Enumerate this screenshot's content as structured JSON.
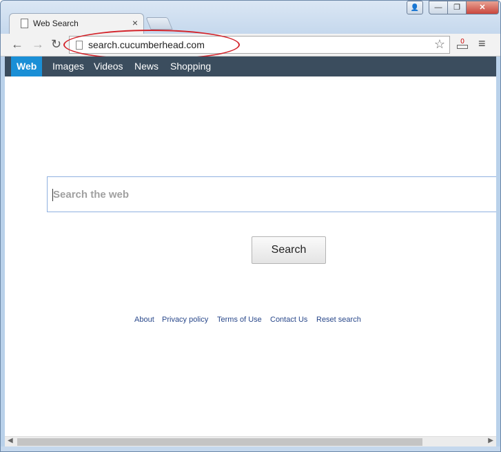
{
  "browser": {
    "tab_title": "Web Search",
    "tab_close": "×",
    "url": "search.cucumberhead.com",
    "star_icon": "☆",
    "menu_icon": "≡",
    "ext_badge": "0",
    "window_controls": {
      "user": "👤",
      "minimize": "—",
      "maximize": "❐",
      "close": "✕"
    }
  },
  "nav": {
    "items": [
      {
        "label": "Web",
        "active": true
      },
      {
        "label": "Images"
      },
      {
        "label": "Videos"
      },
      {
        "label": "News"
      },
      {
        "label": "Shopping"
      }
    ]
  },
  "search": {
    "placeholder": "Search the web",
    "button_label": "Search"
  },
  "footer": {
    "links": [
      "About",
      "Privacy policy",
      "Terms of Use",
      "Contact Us",
      "Reset search"
    ]
  },
  "colors": {
    "nav_bg": "#3b4d5e",
    "active_tab": "#1a8fd6",
    "highlight_ellipse": "#d3232a",
    "link": "#28478a",
    "close_button": "#c9463d"
  }
}
